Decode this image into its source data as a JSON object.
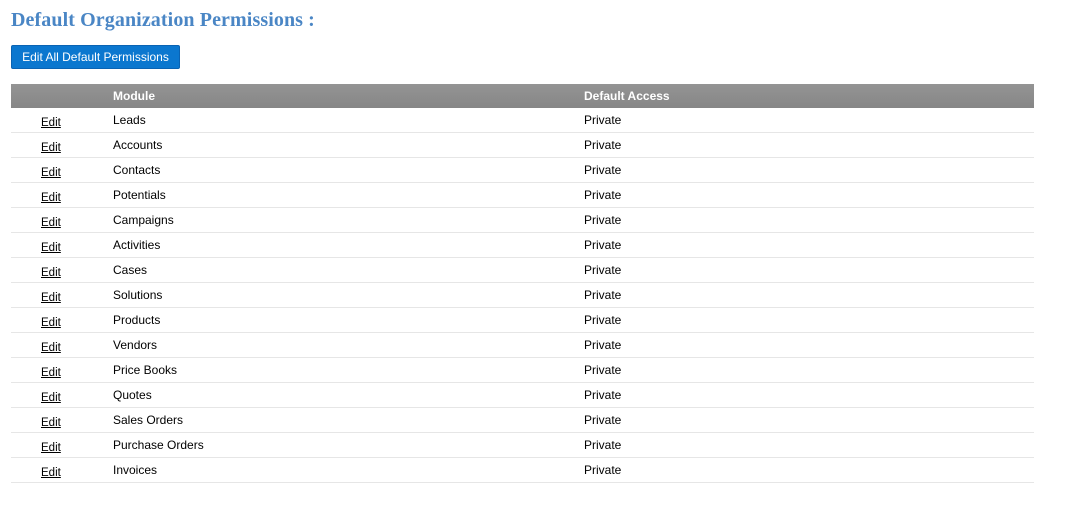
{
  "page": {
    "title": "Default Organization Permissions :",
    "edit_all_label": "Edit All Default Permissions"
  },
  "table": {
    "headers": {
      "action": "",
      "module": "Module",
      "access": "Default Access"
    },
    "rows": [
      {
        "action": "Edit",
        "module": "Leads",
        "access": "Private"
      },
      {
        "action": "Edit",
        "module": "Accounts",
        "access": "Private"
      },
      {
        "action": "Edit",
        "module": "Contacts",
        "access": "Private"
      },
      {
        "action": "Edit",
        "module": "Potentials",
        "access": "Private"
      },
      {
        "action": "Edit",
        "module": "Campaigns",
        "access": "Private"
      },
      {
        "action": "Edit",
        "module": "Activities",
        "access": "Private"
      },
      {
        "action": "Edit",
        "module": "Cases",
        "access": "Private"
      },
      {
        "action": "Edit",
        "module": "Solutions",
        "access": "Private"
      },
      {
        "action": "Edit",
        "module": "Products",
        "access": "Private"
      },
      {
        "action": "Edit",
        "module": "Vendors",
        "access": "Private"
      },
      {
        "action": "Edit",
        "module": "Price Books",
        "access": "Private"
      },
      {
        "action": "Edit",
        "module": "Quotes",
        "access": "Private"
      },
      {
        "action": "Edit",
        "module": "Sales Orders",
        "access": "Private"
      },
      {
        "action": "Edit",
        "module": "Purchase Orders",
        "access": "Private"
      },
      {
        "action": "Edit",
        "module": "Invoices",
        "access": "Private"
      }
    ]
  },
  "colors": {
    "title": "#4a86c5",
    "button_bg": "#0b77cf",
    "header_bg": "#8c8c8c"
  }
}
